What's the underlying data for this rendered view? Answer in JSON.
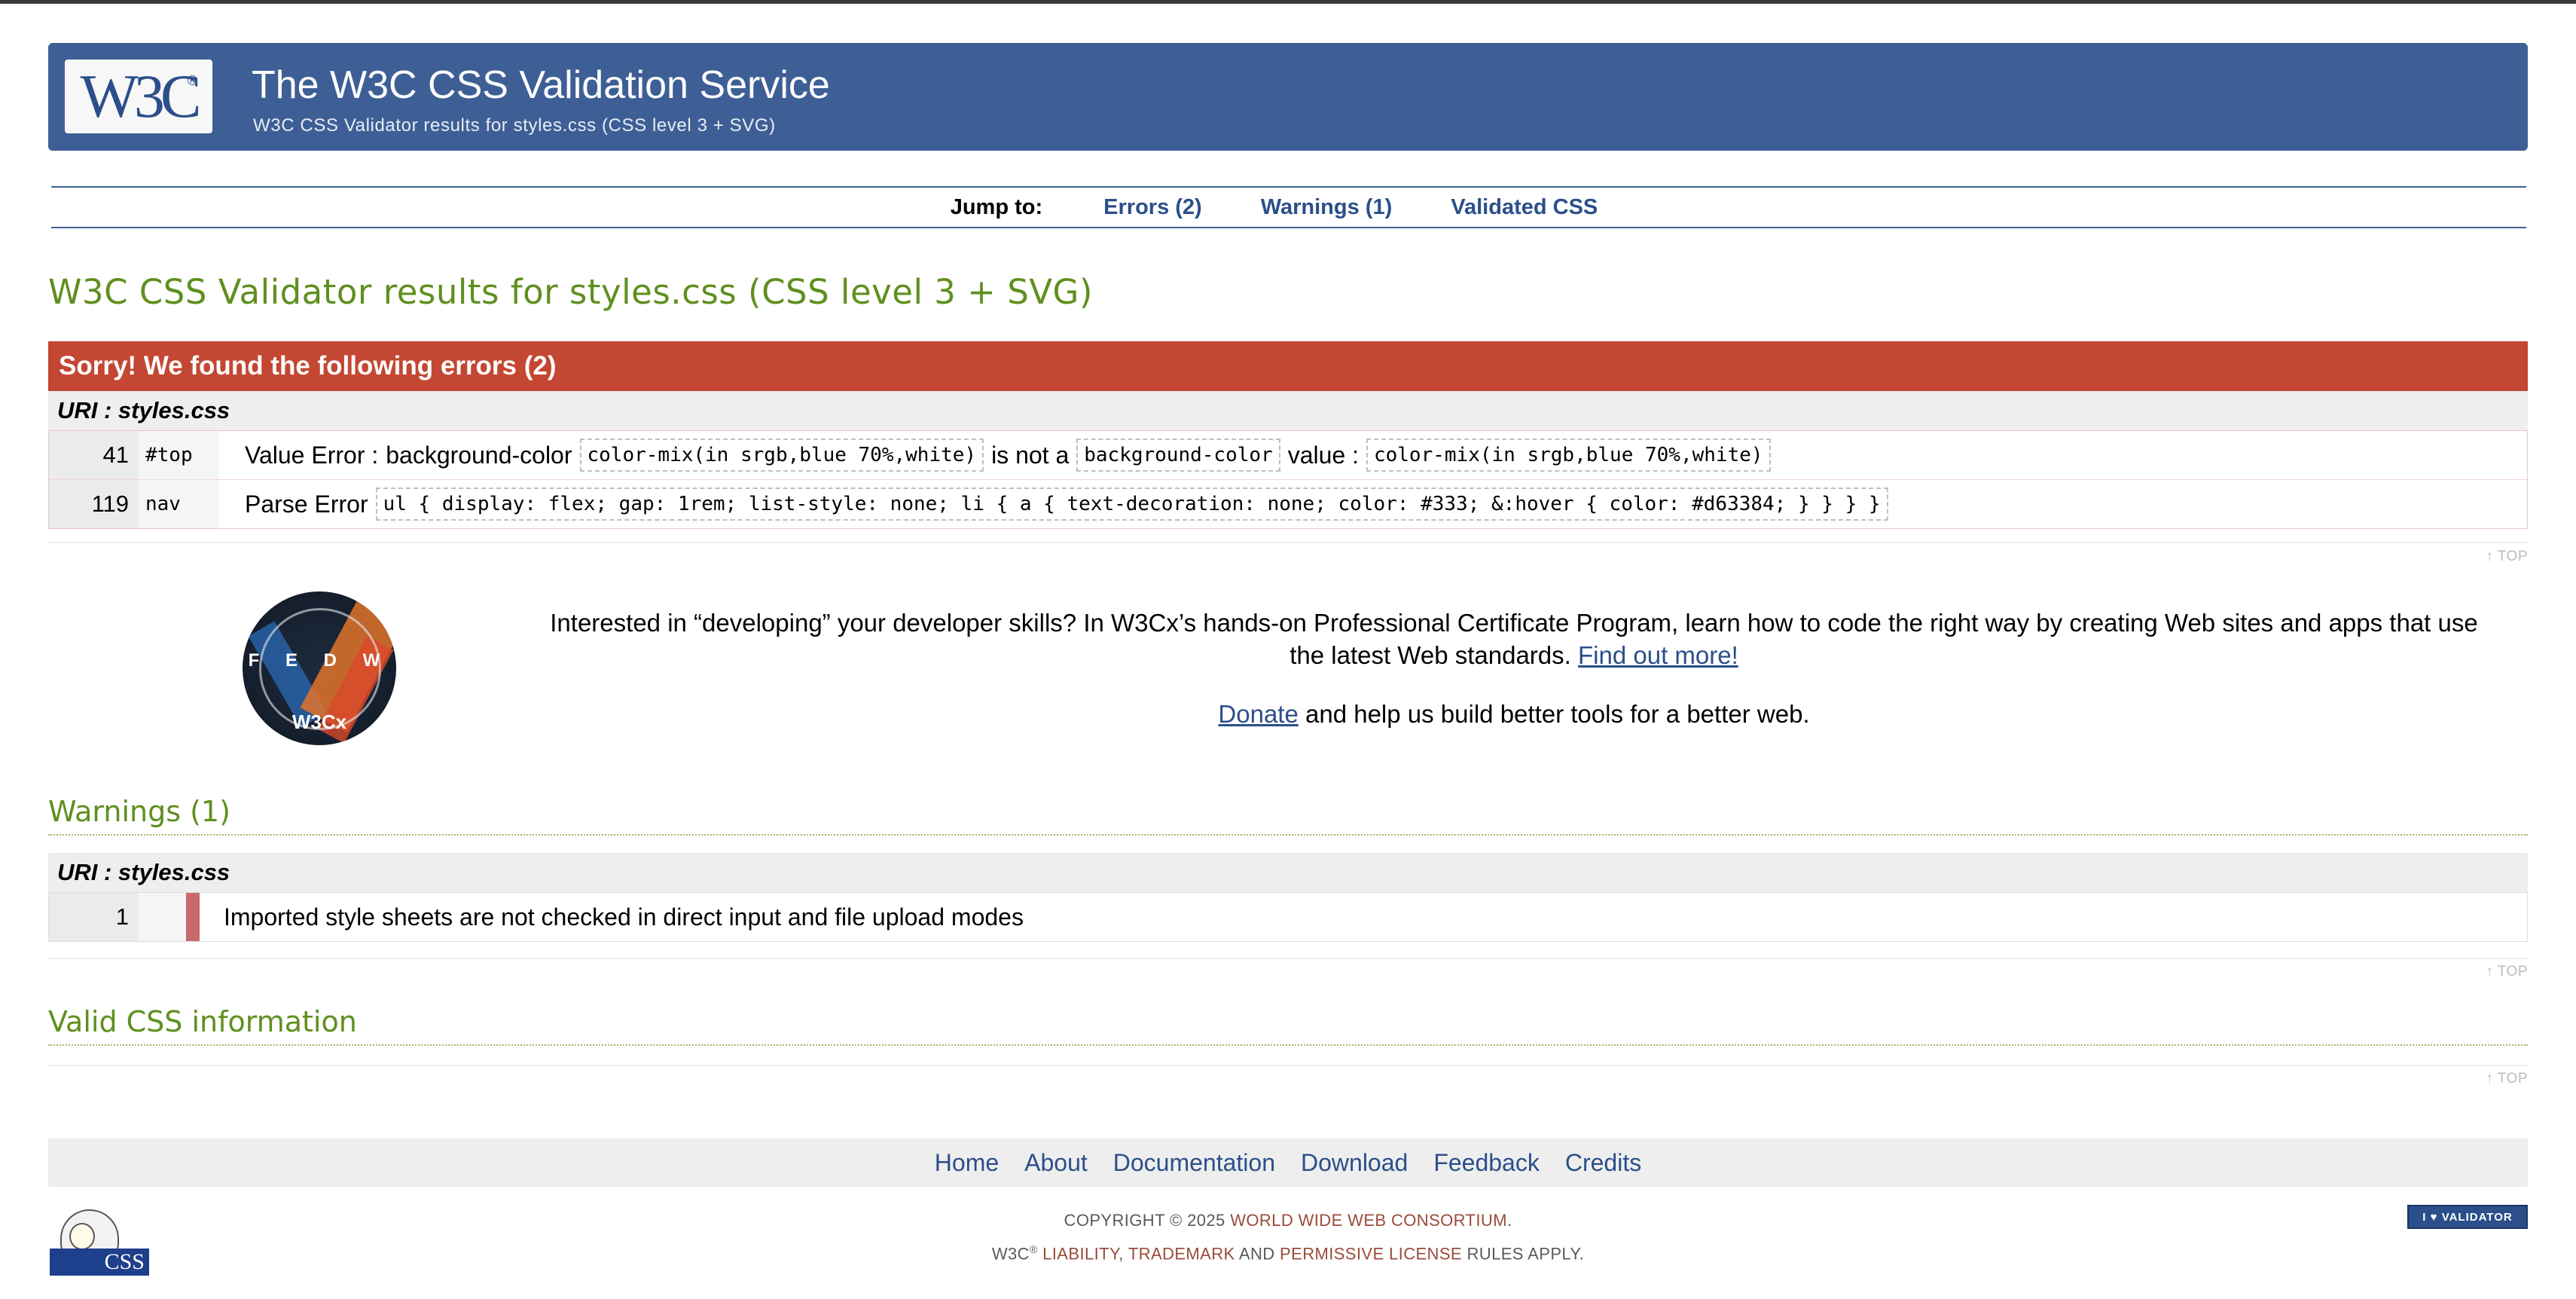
{
  "header": {
    "logo_text": "W3C",
    "logo_reg": "®",
    "title": "The W3C CSS Validation Service",
    "subtitle": "W3C CSS Validator results for styles.css (CSS level 3 + SVG)"
  },
  "jumpbar": {
    "label": "Jump to:",
    "links": [
      "Errors (2)",
      "Warnings (1)",
      "Validated CSS"
    ]
  },
  "results_title": "W3C CSS Validator results for styles.css (CSS level 3 + SVG)",
  "errors": {
    "banner": "Sorry! We found the following errors (2)",
    "uri": "URI : styles.css",
    "rows": [
      {
        "line": "41",
        "context": "#top",
        "type": "Value Error :",
        "property": "background-color",
        "code1": "color-mix(in srgb,blue 70%,white)",
        "mid": "is not a",
        "code2": "background-color",
        "after": "value :",
        "code3": "color-mix(in srgb,blue 70%,white)"
      },
      {
        "line": "119",
        "context": "nav",
        "type": "Parse Error",
        "code1": "ul { display: flex; gap: 1rem; list-style: none; li { a { text-decoration: none; color: #333; &:hover { color: #d63384; } } } }"
      }
    ]
  },
  "top_link": "↑ TOP",
  "promo": {
    "image_letters": "F E D W",
    "image_brand": "W3Cx",
    "text": "Interested in “developing” your developer skills? In W3Cx’s hands-on Professional Certificate Program, learn how to code the right way by creating Web sites and apps that use the latest Web standards.",
    "link": "Find out more!",
    "donate_link": "Donate",
    "donate_text": " and help us build better tools for a better web."
  },
  "warnings": {
    "title": "Warnings (1)",
    "uri": "URI : styles.css",
    "rows": [
      {
        "line": "1",
        "message": "Imported style sheets are not checked in direct input and file upload modes"
      }
    ]
  },
  "valid_css": {
    "title": "Valid CSS information"
  },
  "footer": {
    "nav": [
      "Home",
      "About",
      "Documentation",
      "Download",
      "Feedback",
      "Credits"
    ],
    "css_badge": "CSS",
    "copyright_prefix": "COPYRIGHT © 2025 ",
    "copyright_org": "WORLD WIDE WEB CONSORTIUM",
    "copyright_suffix": ".",
    "w3c": "W3C",
    "reg": "®",
    "liability": "LIABILITY",
    "trademark": "TRADEMARK",
    "and": " AND ",
    "license": "PERMISSIVE LICENSE",
    "rules": " RULES APPLY.",
    "i_love": "I ♥ VALIDATOR"
  }
}
